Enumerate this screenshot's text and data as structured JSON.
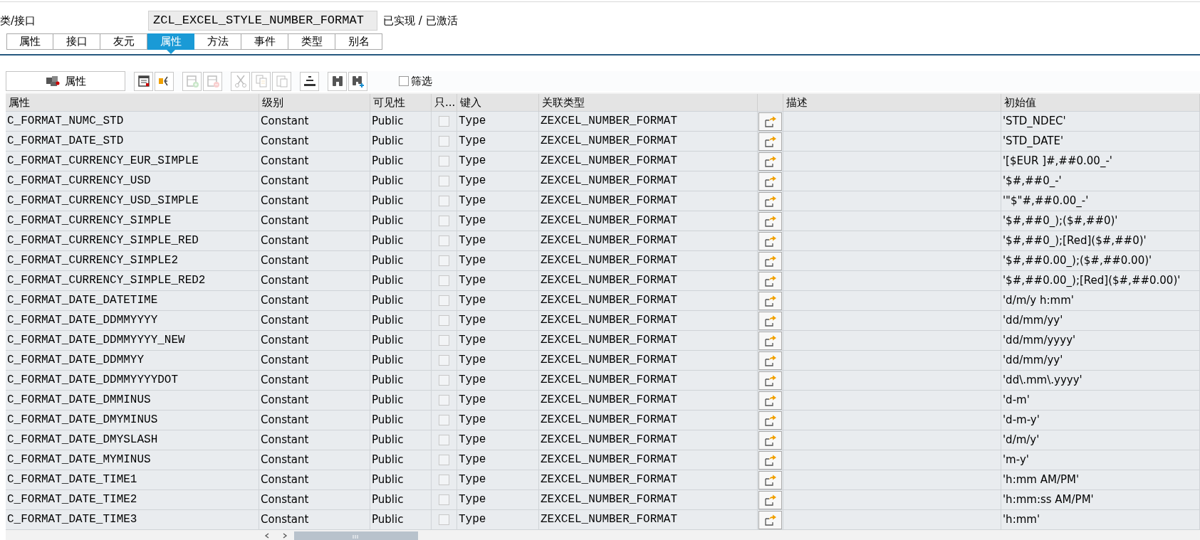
{
  "header": {
    "label": "类/接口",
    "value": "ZCL_EXCEL_STYLE_NUMBER_FORMAT",
    "status": "已实现 / 已激活"
  },
  "tabs": [
    {
      "label": "属性",
      "selected": false
    },
    {
      "label": "接口",
      "selected": false
    },
    {
      "label": "友元",
      "selected": false
    },
    {
      "label": "属性",
      "selected": true
    },
    {
      "label": "方法",
      "selected": false
    },
    {
      "label": "事件",
      "selected": false
    },
    {
      "label": "类型",
      "selected": false
    },
    {
      "label": "别名",
      "selected": false
    }
  ],
  "toolbar": {
    "button": {
      "label": "属性"
    },
    "icons": [
      {
        "disabled": false
      },
      {
        "disabled": false
      },
      {
        "disabled": true
      },
      {
        "disabled": true
      },
      {
        "disabled": true
      },
      {
        "disabled": true
      },
      {
        "disabled": true
      },
      {
        "disabled": false
      },
      {
        "disabled": false
      },
      {
        "disabled": false
      }
    ],
    "filter": {
      "label": "筛选",
      "checked": false
    }
  },
  "table": {
    "columns": [
      "属性",
      "级别",
      "可见性",
      "只...",
      "键入",
      "关联类型",
      "描述",
      "初始值"
    ],
    "rows": [
      {
        "name": "C_FORMAT_NUMC_STD",
        "level": "Constant",
        "visibility": "Public",
        "read_only": false,
        "typing": "Type",
        "type": "ZEXCEL_NUMBER_FORMAT",
        "initial": "'STD_NDEC'"
      },
      {
        "name": "C_FORMAT_DATE_STD",
        "level": "Constant",
        "visibility": "Public",
        "read_only": false,
        "typing": "Type",
        "type": "ZEXCEL_NUMBER_FORMAT",
        "initial": "'STD_DATE'"
      },
      {
        "name": "C_FORMAT_CURRENCY_EUR_SIMPLE",
        "level": "Constant",
        "visibility": "Public",
        "read_only": false,
        "typing": "Type",
        "type": "ZEXCEL_NUMBER_FORMAT",
        "initial": "'[$EUR ]#,##0.00_-'"
      },
      {
        "name": "C_FORMAT_CURRENCY_USD",
        "level": "Constant",
        "visibility": "Public",
        "read_only": false,
        "typing": "Type",
        "type": "ZEXCEL_NUMBER_FORMAT",
        "initial": "'$#,##0_-'"
      },
      {
        "name": "C_FORMAT_CURRENCY_USD_SIMPLE",
        "level": "Constant",
        "visibility": "Public",
        "read_only": false,
        "typing": "Type",
        "type": "ZEXCEL_NUMBER_FORMAT",
        "initial": "'\"$\"#,##0.00_-'"
      },
      {
        "name": "C_FORMAT_CURRENCY_SIMPLE",
        "level": "Constant",
        "visibility": "Public",
        "read_only": false,
        "typing": "Type",
        "type": "ZEXCEL_NUMBER_FORMAT",
        "initial": "'$#,##0_);($#,##0)'"
      },
      {
        "name": "C_FORMAT_CURRENCY_SIMPLE_RED",
        "level": "Constant",
        "visibility": "Public",
        "read_only": false,
        "typing": "Type",
        "type": "ZEXCEL_NUMBER_FORMAT",
        "initial": "'$#,##0_);[Red]($#,##0)'"
      },
      {
        "name": "C_FORMAT_CURRENCY_SIMPLE2",
        "level": "Constant",
        "visibility": "Public",
        "read_only": false,
        "typing": "Type",
        "type": "ZEXCEL_NUMBER_FORMAT",
        "initial": "'$#,##0.00_);($#,##0.00)'"
      },
      {
        "name": "C_FORMAT_CURRENCY_SIMPLE_RED2",
        "level": "Constant",
        "visibility": "Public",
        "read_only": false,
        "typing": "Type",
        "type": "ZEXCEL_NUMBER_FORMAT",
        "initial": "'$#,##0.00_);[Red]($#,##0.00)'"
      },
      {
        "name": "C_FORMAT_DATE_DATETIME",
        "level": "Constant",
        "visibility": "Public",
        "read_only": false,
        "typing": "Type",
        "type": "ZEXCEL_NUMBER_FORMAT",
        "initial": "'d/m/y h:mm'"
      },
      {
        "name": "C_FORMAT_DATE_DDMMYYYY",
        "level": "Constant",
        "visibility": "Public",
        "read_only": false,
        "typing": "Type",
        "type": "ZEXCEL_NUMBER_FORMAT",
        "initial": "'dd/mm/yy'"
      },
      {
        "name": "C_FORMAT_DATE_DDMMYYYY_NEW",
        "level": "Constant",
        "visibility": "Public",
        "read_only": false,
        "typing": "Type",
        "type": "ZEXCEL_NUMBER_FORMAT",
        "initial": "'dd/mm/yyyy'"
      },
      {
        "name": "C_FORMAT_DATE_DDMMYY",
        "level": "Constant",
        "visibility": "Public",
        "read_only": false,
        "typing": "Type",
        "type": "ZEXCEL_NUMBER_FORMAT",
        "initial": "'dd/mm/yy'"
      },
      {
        "name": "C_FORMAT_DATE_DDMMYYYYDOT",
        "level": "Constant",
        "visibility": "Public",
        "read_only": false,
        "typing": "Type",
        "type": "ZEXCEL_NUMBER_FORMAT",
        "initial": "'dd\\.mm\\.yyyy'"
      },
      {
        "name": "C_FORMAT_DATE_DMMINUS",
        "level": "Constant",
        "visibility": "Public",
        "read_only": false,
        "typing": "Type",
        "type": "ZEXCEL_NUMBER_FORMAT",
        "initial": "'d-m'"
      },
      {
        "name": "C_FORMAT_DATE_DMYMINUS",
        "level": "Constant",
        "visibility": "Public",
        "read_only": false,
        "typing": "Type",
        "type": "ZEXCEL_NUMBER_FORMAT",
        "initial": "'d-m-y'"
      },
      {
        "name": "C_FORMAT_DATE_DMYSLASH",
        "level": "Constant",
        "visibility": "Public",
        "read_only": false,
        "typing": "Type",
        "type": "ZEXCEL_NUMBER_FORMAT",
        "initial": "'d/m/y'"
      },
      {
        "name": "C_FORMAT_DATE_MYMINUS",
        "level": "Constant",
        "visibility": "Public",
        "read_only": false,
        "typing": "Type",
        "type": "ZEXCEL_NUMBER_FORMAT",
        "initial": "'m-y'"
      },
      {
        "name": "C_FORMAT_DATE_TIME1",
        "level": "Constant",
        "visibility": "Public",
        "read_only": false,
        "typing": "Type",
        "type": "ZEXCEL_NUMBER_FORMAT",
        "initial": "'h:mm AM/PM'"
      },
      {
        "name": "C_FORMAT_DATE_TIME2",
        "level": "Constant",
        "visibility": "Public",
        "read_only": false,
        "typing": "Type",
        "type": "ZEXCEL_NUMBER_FORMAT",
        "initial": "'h:mm:ss AM/PM'"
      },
      {
        "name": "C_FORMAT_DATE_TIME3",
        "level": "Constant",
        "visibility": "Public",
        "read_only": false,
        "typing": "Type",
        "type": "ZEXCEL_NUMBER_FORMAT",
        "initial": "'h:mm'"
      }
    ]
  }
}
